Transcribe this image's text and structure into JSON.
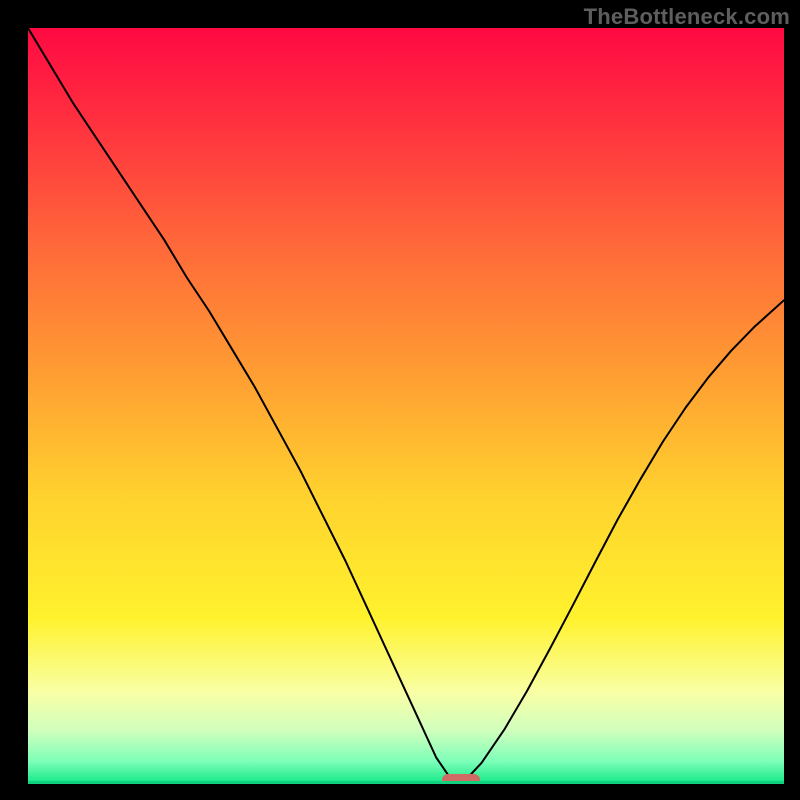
{
  "watermark": "TheBottleneck.com",
  "colors": {
    "frame": "#000000",
    "marker": "#cf6b63",
    "curve": "#000000",
    "gradient_top": "#ff0943",
    "gradient_mid": "#fff22d",
    "gradient_bottom": "#12e787"
  },
  "chart_data": {
    "type": "line",
    "title": "",
    "xlabel": "",
    "ylabel": "",
    "xlim": [
      0,
      100
    ],
    "ylim": [
      0,
      100
    ],
    "grid": false,
    "legend": false,
    "annotations": [
      {
        "kind": "watermark",
        "text": "TheBottleneck.com",
        "position": "top-right"
      },
      {
        "kind": "marker",
        "shape": "pill",
        "x": 57,
        "y": 0,
        "color": "#cf6b63"
      }
    ],
    "x": [
      0,
      3,
      6,
      9,
      12,
      15,
      18,
      21,
      24,
      27,
      30,
      33,
      36,
      39,
      42,
      45,
      48,
      51,
      54,
      55.5,
      57,
      58.5,
      60,
      63,
      66,
      69,
      72,
      75,
      78,
      81,
      84,
      87,
      90,
      93,
      96,
      100
    ],
    "y": [
      100,
      95,
      90,
      85.5,
      81,
      76.5,
      72,
      67,
      62.5,
      57.5,
      52.5,
      47,
      41.5,
      35.5,
      29.5,
      23,
      16.5,
      10,
      3.5,
      1.3,
      0,
      1.2,
      2.8,
      7.2,
      12.3,
      17.8,
      23.5,
      29.3,
      35,
      40.3,
      45.3,
      49.8,
      53.8,
      57.3,
      60.4,
      64
    ],
    "valley": {
      "x": 57,
      "y": 0
    }
  }
}
